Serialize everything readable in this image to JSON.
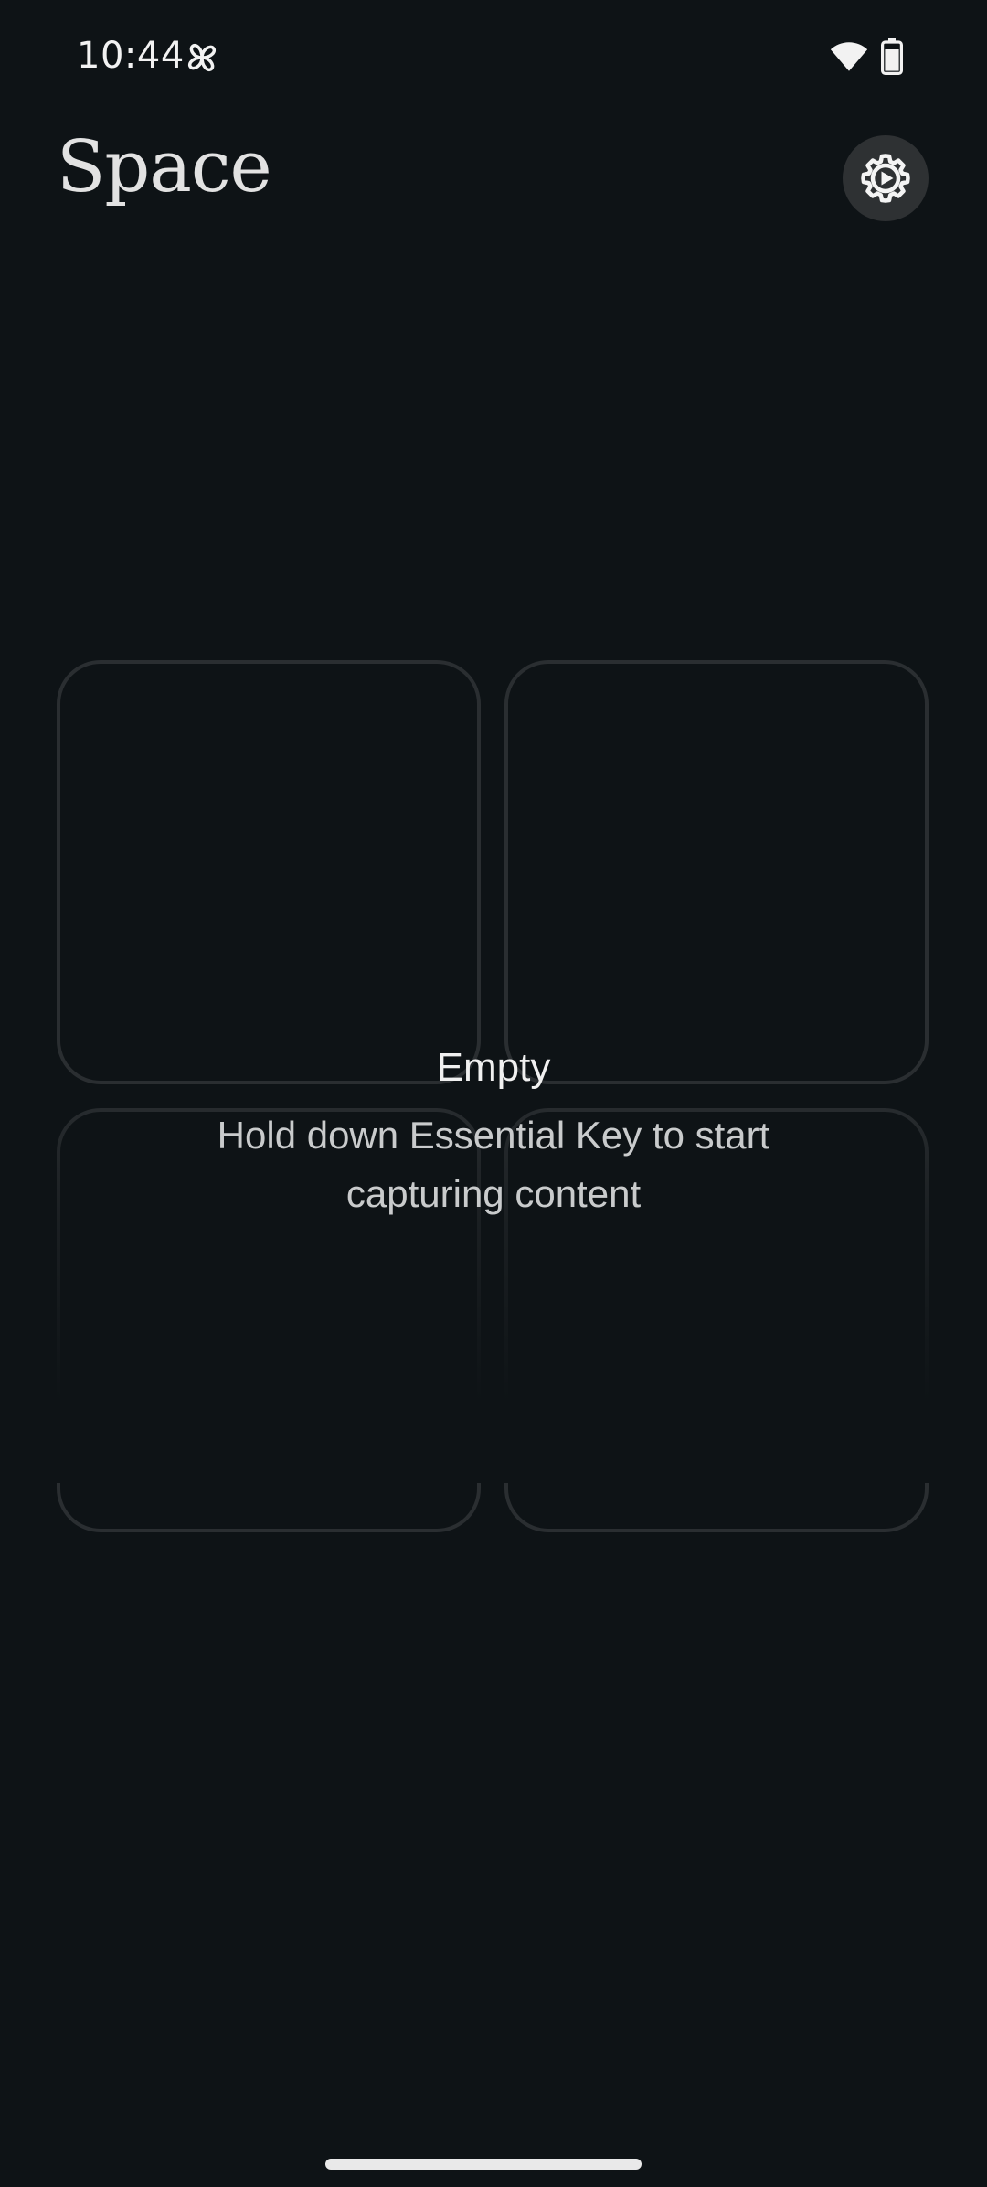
{
  "status_bar": {
    "time": "10:44",
    "icons": [
      "pinwheel-icon",
      "wifi-icon",
      "battery-icon"
    ]
  },
  "header": {
    "title": "Space",
    "settings_icon": "gear-icon"
  },
  "empty_state": {
    "title": "Empty",
    "message": "Hold down Essential Key to start capturing content"
  },
  "colors": {
    "background": "#0e1316",
    "tile_border": "#2a2e31",
    "settings_button_bg": "#2e3133",
    "text_primary": "#f0f0f0",
    "text_secondary": "#c9cbcc"
  }
}
